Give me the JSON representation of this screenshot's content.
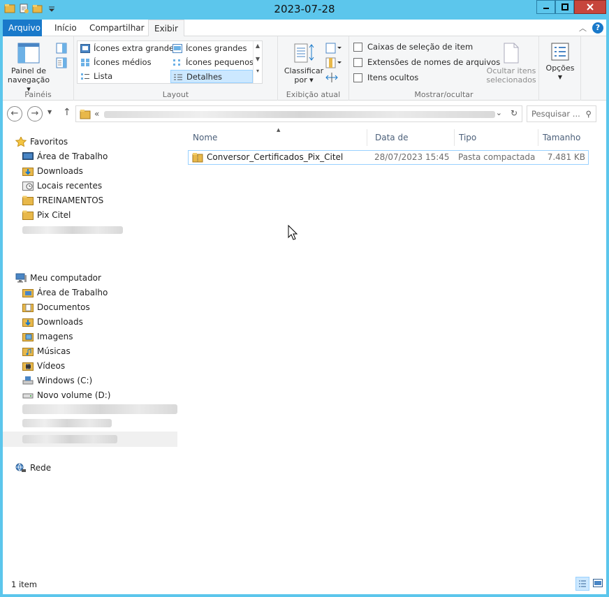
{
  "window": {
    "title": "2023-07-28"
  },
  "ribbon": {
    "tabs": {
      "file": "Arquivo",
      "home": "Início",
      "share": "Compartilhar",
      "view": "Exibir"
    },
    "panes": {
      "nav_pane_label_1": "Painel de",
      "nav_pane_label_2": "navegação",
      "group_label": "Painéis"
    },
    "layout": {
      "items": [
        "Ícones extra grandes",
        "Ícones grandes",
        "Ícones médios",
        "Ícones pequenos",
        "Lista",
        "Detalhes"
      ],
      "selected": "Detalhes",
      "group_label": "Layout"
    },
    "current_view": {
      "sort_label_1": "Classificar",
      "sort_label_2": "por",
      "group_label": "Exibição atual"
    },
    "show_hide": {
      "checkboxes": [
        "Caixas de seleção de item",
        "Extensões de nomes de arquivos",
        "Itens ocultos"
      ],
      "hide_selected_1": "Ocultar itens",
      "hide_selected_2": "selecionados",
      "group_label": "Mostrar/ocultar"
    },
    "options_label": "Opções"
  },
  "address": {
    "prefix": "«",
    "search_placeholder": "Pesquisar ..."
  },
  "nav": {
    "favorites_label": "Favoritos",
    "favorites": [
      "Área de Trabalho",
      "Downloads",
      "Locais recentes",
      "TREINAMENTOS",
      "Pix Citel"
    ],
    "computer_label": "Meu computador",
    "computer": [
      "Área de Trabalho",
      "Documentos",
      "Downloads",
      "Imagens",
      "Músicas",
      "Vídeos",
      "Windows (C:)",
      "Novo volume (D:)"
    ],
    "network_label": "Rede"
  },
  "columns": {
    "name": "Nome",
    "modified": "Data de modificaç...",
    "type": "Tipo",
    "size": "Tamanho"
  },
  "files": [
    {
      "name": "Conversor_Certificados_Pix_Citel",
      "modified": "28/07/2023 15:45",
      "type": "Pasta compactada",
      "size": "7.481 KB"
    }
  ],
  "status": {
    "count": "1 item"
  },
  "colors": {
    "frame": "#5cc6ec",
    "file_tab": "#1979ca",
    "selection": "#cce8ff",
    "close_button": "#c7463c"
  }
}
